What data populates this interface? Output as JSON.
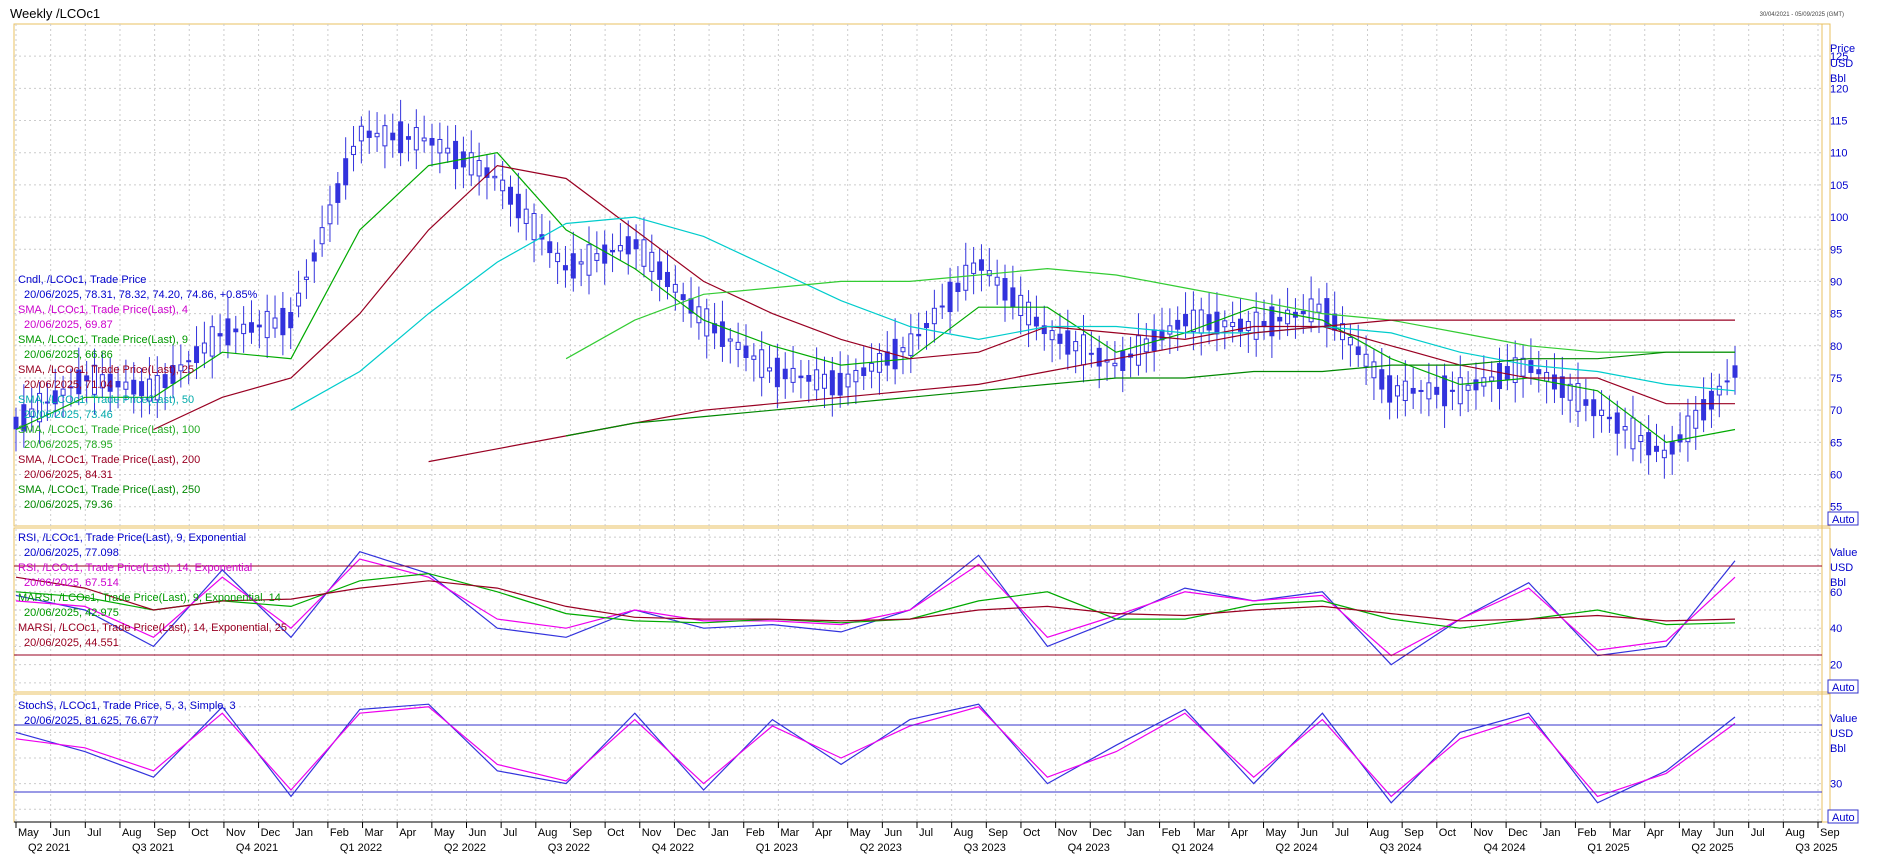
{
  "window": {
    "title": "Weekly /LCOc1",
    "date_range": "30/04/2021 - 05/09/2025 (GMT)"
  },
  "colors": {
    "candle": "#3333dd",
    "sma4": "#ee00ee",
    "sma9": "#00aa00",
    "sma25": "#990022",
    "sma50": "#00cccc",
    "sma100": "#33cc33",
    "sma200": "#990022",
    "sma250": "#008800",
    "grid": "#c8c8c8",
    "frame": "#e8c060",
    "axis": "#0000cc"
  },
  "panels": {
    "price": {
      "axis_labels": [
        "Price",
        "USD",
        "Bbl"
      ],
      "ticks": [
        55,
        60,
        65,
        70,
        75,
        80,
        85,
        90,
        95,
        100,
        105,
        110,
        115,
        120,
        125
      ],
      "auto_label": "Auto",
      "legend": [
        {
          "name": "Cndl, /LCOc1, Trade Price",
          "value": "20/06/2025, 78.31, 78.32, 74.20, 74.86, +0.85%",
          "color": "#0000cc"
        },
        {
          "name": "SMA, /LCOc1, Trade Price(Last),  4",
          "value": "20/06/2025, 69.87",
          "color": "#cc00cc"
        },
        {
          "name": "SMA, /LCOc1, Trade Price(Last),  9",
          "value": "20/06/2025, 66.86",
          "color": "#009900"
        },
        {
          "name": "SMA, /LCOc1, Trade Price(Last),  25",
          "value": "20/06/2025, 71.04",
          "color": "#990022"
        },
        {
          "name": "SMA, /LCOc1, Trade Price(Last),  50",
          "value": "20/06/2025, 73.46",
          "color": "#00aaaa"
        },
        {
          "name": "SMA, /LCOc1, Trade Price(Last),  100",
          "value": "20/06/2025, 78.95",
          "color": "#22aa22"
        },
        {
          "name": "SMA, /LCOc1, Trade Price(Last),  200",
          "value": "20/06/2025, 84.31",
          "color": "#990022"
        },
        {
          "name": "SMA, /LCOc1, Trade Price(Last),  250",
          "value": "20/06/2025, 79.36",
          "color": "#008800"
        }
      ]
    },
    "rsi": {
      "axis_labels": [
        "Value",
        "USD",
        "Bbl"
      ],
      "ticks": [
        20,
        40,
        60
      ],
      "auto_label": "Auto",
      "legend": [
        {
          "name": "RSI, /LCOc1, Trade Price(Last),  9, Exponential",
          "value": "20/06/2025, 77.098",
          "color": "#0000cc"
        },
        {
          "name": "RSI, /LCOc1, Trade Price(Last),  14, Exponential",
          "value": "20/06/2025, 67.514",
          "color": "#cc00cc"
        },
        {
          "name": "MARSI, /LCOc1, Trade Price(Last),  9, Exponential, 14",
          "value": "20/06/2025, 42.975",
          "color": "#009900"
        },
        {
          "name": "MARSI, /LCOc1, Trade Price(Last),  14, Exponential, 25",
          "value": "20/06/2025, 44.551",
          "color": "#990022"
        }
      ]
    },
    "stoch": {
      "axis_labels": [
        "Value",
        "USD",
        "Bbl"
      ],
      "ticks": [
        30
      ],
      "auto_label": "Auto",
      "legend": [
        {
          "name": "StochS, /LCOc1, Trade Price,  5, 3, Simple, 3",
          "value": "20/06/2025, 81.625, 76.677",
          "color": "#0000cc"
        }
      ]
    }
  },
  "x_axis": {
    "months": [
      "May",
      "Jun",
      "Jul",
      "Aug",
      "Sep",
      "Oct",
      "Nov",
      "Dec",
      "Jan",
      "Feb",
      "Mar",
      "Apr",
      "May",
      "Jun",
      "Jul",
      "Aug",
      "Sep",
      "Oct",
      "Nov",
      "Dec",
      "Jan",
      "Feb",
      "Mar",
      "Apr",
      "May",
      "Jun",
      "Jul",
      "Aug",
      "Sep",
      "Oct",
      "Nov",
      "Dec",
      "Jan",
      "Feb",
      "Mar",
      "Apr",
      "May",
      "Jun",
      "Jul",
      "Aug",
      "Sep",
      "Oct",
      "Nov",
      "Dec",
      "Jan",
      "Feb",
      "Mar",
      "Apr",
      "May",
      "Jun",
      "Jul",
      "Aug",
      "Sep"
    ],
    "quarters": [
      "Q2 2021",
      "Q3 2021",
      "Q4 2021",
      "Q1 2022",
      "Q2 2022",
      "Q3 2022",
      "Q4 2022",
      "Q1 2023",
      "Q2 2023",
      "Q3 2023",
      "Q4 2023",
      "Q1 2024",
      "Q2 2024",
      "Q3 2024",
      "Q4 2024",
      "Q1 2025",
      "Q2 2025",
      "Q3 2025"
    ]
  },
  "chart_data": [
    {
      "type": "line",
      "panel": "price",
      "x": [
        "2021-05",
        "2021-07",
        "2021-09",
        "2021-11",
        "2022-01",
        "2022-03",
        "2022-05",
        "2022-07",
        "2022-09",
        "2022-11",
        "2023-01",
        "2023-03",
        "2023-05",
        "2023-07",
        "2023-09",
        "2023-11",
        "2024-01",
        "2024-03",
        "2024-05",
        "2024-07",
        "2024-09",
        "2024-11",
        "2025-01",
        "2025-03",
        "2025-05",
        "2025-06"
      ],
      "ylim": [
        52,
        130
      ],
      "series": [
        {
          "name": "Cndl, /LCOc1, Trade Price",
          "values": [
            68,
            75,
            73,
            82,
            84,
            113,
            112,
            106,
            92,
            96,
            84,
            76,
            74,
            80,
            93,
            82,
            77,
            84,
            83,
            86,
            73,
            73,
            77,
            70,
            63,
            76
          ]
        },
        {
          "name": "SMA, /LCOc1, Trade Price(Last),  9",
          "values": [
            67,
            72,
            72,
            79,
            78,
            98,
            108,
            110,
            98,
            92,
            84,
            80,
            77,
            78,
            86,
            86,
            79,
            82,
            86,
            84,
            78,
            74,
            75,
            73,
            65,
            67
          ]
        },
        {
          "name": "SMA, /LCOc1, Trade Price(Last),  25",
          "values": [
            null,
            null,
            67,
            72,
            75,
            85,
            98,
            108,
            106,
            98,
            90,
            85,
            81,
            78,
            79,
            83,
            82,
            81,
            83,
            83,
            80,
            77,
            75,
            75,
            71,
            71
          ]
        },
        {
          "name": "SMA, /LCOc1, Trade Price(Last),  50",
          "values": [
            null,
            null,
            null,
            null,
            70,
            76,
            85,
            93,
            99,
            100,
            97,
            92,
            87,
            83,
            81,
            83,
            83,
            82,
            82,
            83,
            82,
            79,
            77,
            76,
            74,
            73
          ]
        },
        {
          "name": "SMA, /LCOc1, Trade Price(Last),  100",
          "values": [
            null,
            null,
            null,
            null,
            null,
            null,
            null,
            null,
            78,
            84,
            88,
            89,
            90,
            90,
            91,
            92,
            91,
            89,
            87,
            85,
            84,
            82,
            80,
            79,
            79,
            79
          ]
        },
        {
          "name": "SMA, /LCOc1, Trade Price(Last),  200",
          "values": [
            null,
            null,
            null,
            null,
            null,
            null,
            62,
            64,
            66,
            68,
            70,
            71,
            72,
            73,
            74,
            76,
            78,
            80,
            82,
            83,
            84,
            84,
            84,
            84,
            84,
            84
          ]
        },
        {
          "name": "SMA, /LCOc1, Trade Price(Last),  250",
          "values": [
            null,
            null,
            null,
            null,
            null,
            null,
            null,
            null,
            66,
            68,
            69,
            70,
            71,
            72,
            73,
            74,
            75,
            75,
            76,
            76,
            77,
            77,
            78,
            78,
            79,
            79
          ]
        }
      ]
    },
    {
      "type": "line",
      "panel": "rsi",
      "ylim": [
        5,
        95
      ],
      "series": [
        {
          "name": "RSI, /LCOc1, Trade Price(Last),  9, Exponential",
          "values": [
            58,
            50,
            30,
            72,
            35,
            82,
            70,
            40,
            35,
            50,
            40,
            42,
            38,
            50,
            80,
            30,
            45,
            62,
            55,
            60,
            20,
            45,
            65,
            25,
            30,
            77
          ]
        },
        {
          "name": "RSI, /LCOc1, Trade Price(Last),  14, Exponential",
          "values": [
            55,
            52,
            35,
            68,
            40,
            78,
            68,
            45,
            40,
            50,
            44,
            44,
            42,
            50,
            75,
            35,
            47,
            60,
            55,
            58,
            25,
            45,
            62,
            28,
            33,
            68
          ]
        },
        {
          "name": "MARSI, /LCOc1, Trade Price(Last),  9, Exponential, 14",
          "values": [
            60,
            57,
            50,
            55,
            52,
            66,
            70,
            60,
            48,
            44,
            43,
            45,
            43,
            45,
            55,
            60,
            45,
            45,
            53,
            55,
            45,
            40,
            45,
            50,
            42,
            43
          ]
        },
        {
          "name": "MARSI, /LCOc1, Trade Price(Last),  14, Exponential, 25",
          "values": [
            68,
            62,
            50,
            55,
            56,
            62,
            66,
            62,
            52,
            46,
            45,
            45,
            44,
            45,
            50,
            52,
            48,
            47,
            50,
            52,
            48,
            44,
            45,
            47,
            44,
            45
          ]
        }
      ]
    },
    {
      "type": "line",
      "panel": "stoch",
      "ylim": [
        0,
        100
      ],
      "series": [
        {
          "name": "StochS, /LCOc1, Trade Price,  5, 3, Simple, 3",
          "values": [
            70,
            55,
            35,
            90,
            20,
            88,
            92,
            40,
            30,
            85,
            25,
            80,
            45,
            80,
            92,
            30,
            60,
            88,
            30,
            85,
            15,
            70,
            85,
            15,
            40,
            82
          ]
        },
        {
          "name": "StochS, /LCOc1, Trade Price,  5, 3, Simple, 3 (%D)",
          "values": [
            65,
            58,
            40,
            85,
            25,
            85,
            90,
            45,
            32,
            80,
            30,
            75,
            50,
            75,
            90,
            35,
            55,
            85,
            35,
            80,
            20,
            65,
            82,
            20,
            38,
            77
          ]
        }
      ]
    }
  ]
}
